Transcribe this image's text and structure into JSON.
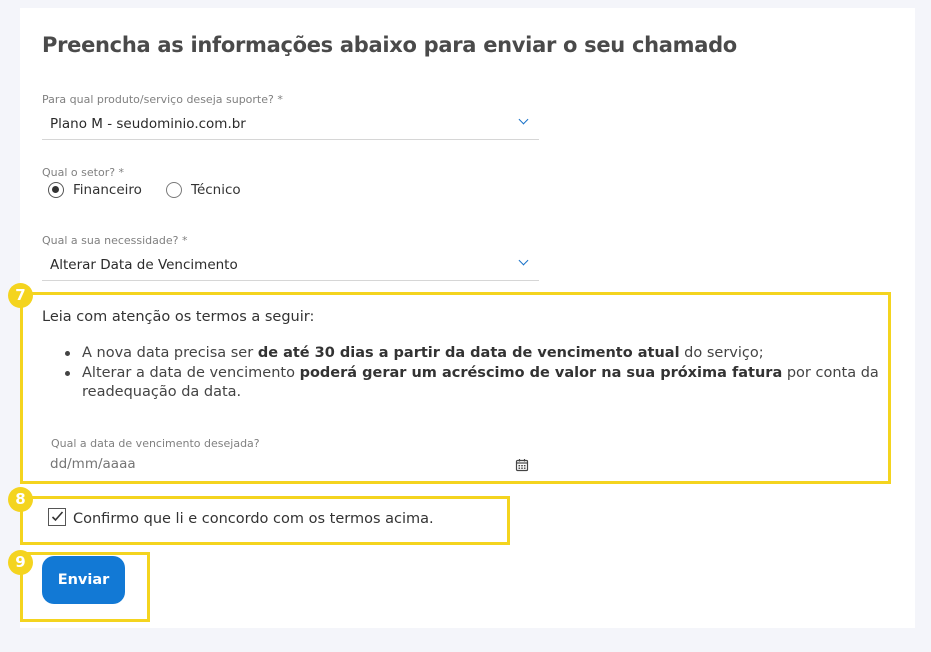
{
  "form": {
    "title": "Preencha as informações abaixo para enviar o seu chamado",
    "product": {
      "label": "Para qual produto/serviço deseja suporte? *",
      "value": "Plano M - seudominio.com.br",
      "icon": "chevron-down-icon"
    },
    "sector": {
      "label": "Qual o setor? *",
      "options": [
        {
          "label": "Financeiro",
          "checked": true
        },
        {
          "label": "Técnico",
          "checked": false
        }
      ]
    },
    "need": {
      "label": "Qual a sua necessidade? *",
      "value": "Alterar Data de Vencimento",
      "icon": "chevron-down-icon"
    },
    "terms": {
      "heading": "Leia com atenção os termos a seguir:",
      "items": [
        {
          "pre": "A nova data precisa ser ",
          "bold": "de até 30 dias a partir da data de vencimento atual",
          "post": " do serviço;"
        },
        {
          "pre": "Alterar a data de vencimento ",
          "bold": "poderá gerar um acréscimo de valor na sua próxima fatura",
          "post": " por conta da readequação da data."
        }
      ]
    },
    "due_date": {
      "label": "Qual a data de vencimento desejada?",
      "placeholder": "dd/mm/aaaa",
      "icon": "calendar-icon"
    },
    "confirm": {
      "label": "Confirmo que li e concordo com os termos acima.",
      "checked": true
    },
    "submit_label": "Enviar"
  },
  "annotations": {
    "badges": [
      "7",
      "8",
      "9"
    ],
    "color": "#f4d41f"
  },
  "colors": {
    "primary_button": "#1279d5",
    "chevron": "#1a73c9",
    "background": "#f4f5fa",
    "card": "#ffffff"
  }
}
